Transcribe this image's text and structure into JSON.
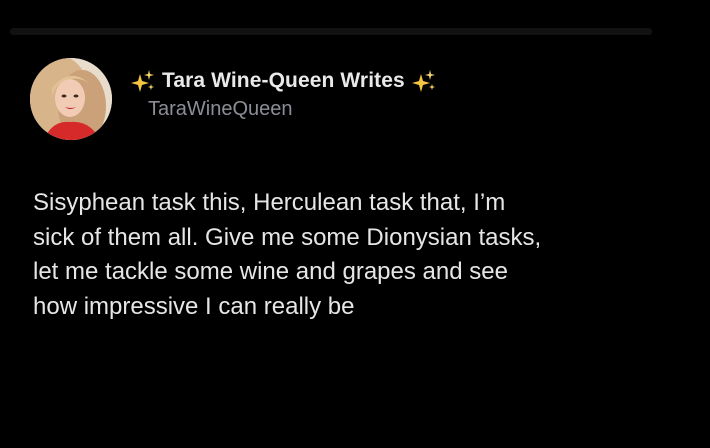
{
  "author": {
    "display_name": "Tara Wine-Queen Writes",
    "handle": "TaraWineQueen",
    "avatar": "avatar-photo",
    "name_decoration_icon": "sparkles-icon",
    "sparkle_color": "#f5c542"
  },
  "tweet": {
    "lines": [
      "Sisyphean task this, Herculean task that, I’m",
      "sick of them all. Give me some Dionysian tasks,",
      "let me tackle some wine and grapes and see",
      "how impressive I can really be"
    ]
  },
  "theme": {
    "background": "#000000",
    "text": "#e6e6e6",
    "secondary_text": "#8b8f95"
  }
}
